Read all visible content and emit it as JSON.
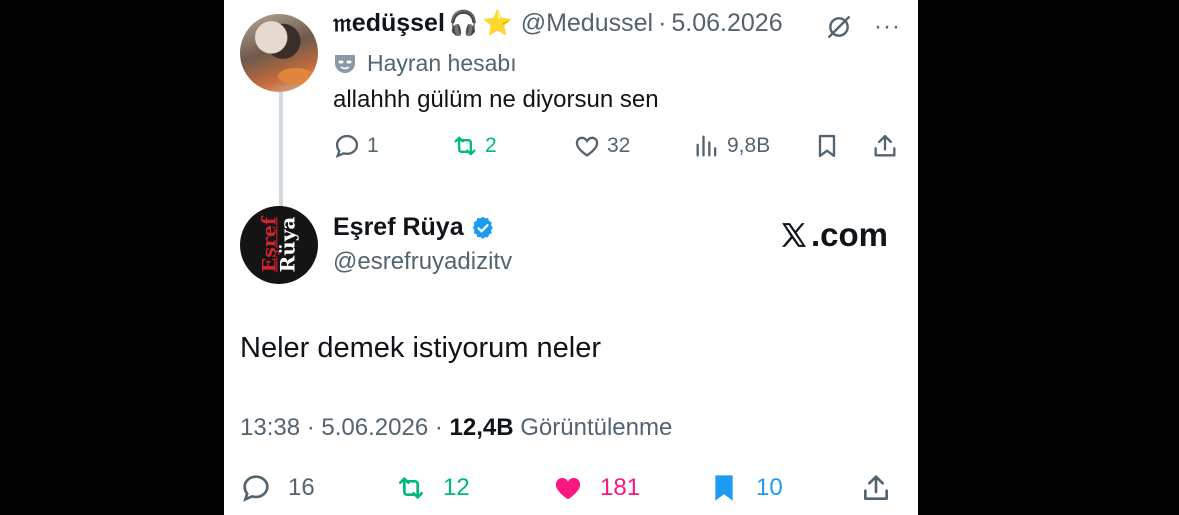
{
  "reply": {
    "display_name": "𝔪edüşsel",
    "emoji_1": "🎧",
    "emoji_2": "⭐",
    "handle": "@Medussel",
    "separator": "·",
    "date": "5.06.2026",
    "more": "···",
    "fan_label": "Hayran hesabı",
    "text": "allahhh gülüm ne diyorsun sen",
    "actions": {
      "replies": "1",
      "reposts": "2",
      "likes": "32",
      "views": "9,8B"
    }
  },
  "main": {
    "display_name": "Eşref Rüya",
    "handle": "@esrefruyadizitv",
    "avatar_logo_line1": "Eşref",
    "avatar_logo_line2": "Rüya",
    "brand": ".com",
    "text": "Neler demek istiyorum neler",
    "time": "13:38",
    "separator": "·",
    "date": "5.06.2026",
    "separator2": "·",
    "views_count": "12,4B",
    "views_label": "Görüntülenme",
    "actions": {
      "replies": "16",
      "reposts": "12",
      "likes": "181",
      "bookmarks": "10"
    }
  },
  "colors": {
    "repost_green": "#00ba7c",
    "like_pink": "#f91880",
    "bookmark_blue": "#1d9bf0",
    "verified_blue": "#1d9bf0",
    "secondary_text": "#536471"
  },
  "icons": [
    "reply-icon",
    "repost-icon",
    "like-icon",
    "views-icon",
    "bookmark-icon",
    "share-icon",
    "grok-icon",
    "verified-badge-icon",
    "x-logo-icon",
    "fan-mask-icon"
  ]
}
